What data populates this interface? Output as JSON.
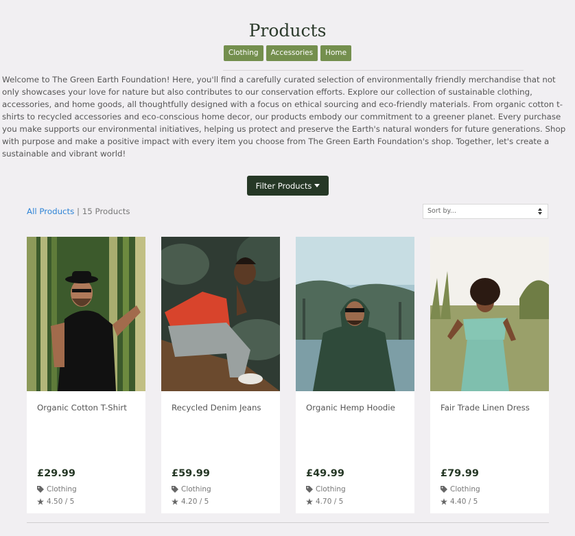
{
  "page": {
    "title": "Products"
  },
  "categories": [
    {
      "label": "Clothing"
    },
    {
      "label": "Accessories"
    },
    {
      "label": "Home"
    }
  ],
  "intro": "Welcome to The Green Earth Foundation! Here, you'll find a carefully curated selection of environmentally friendly merchandise that not only showcases your love for nature but also contributes to our conservation efforts. Explore our collection of sustainable clothing, accessories, and home goods, all thoughtfully designed with a focus on ethical sourcing and eco-friendly materials. From organic cotton t-shirts to recycled accessories and eco-conscious home decor, our products embody our commitment to a greener planet. Every purchase you make supports our environmental initiatives, helping us protect and preserve the Earth's natural wonders for future generations. Shop with purpose and make a positive impact with every item you choose from The Green Earth Foundation's shop. Together, let's create a sustainable and vibrant world!",
  "filter": {
    "label": "Filter Products"
  },
  "listing": {
    "all_link": "All Products",
    "separator": " | ",
    "count": "15 Products"
  },
  "sort": {
    "placeholder": "Sort by..."
  },
  "products": [
    {
      "name": "Organic Cotton T-Shirt",
      "price": "£29.99",
      "category": "Clothing",
      "rating": "4.50 / 5"
    },
    {
      "name": "Recycled Denim Jeans",
      "price": "£59.99",
      "category": "Clothing",
      "rating": "4.20 / 5"
    },
    {
      "name": "Organic Hemp Hoodie",
      "price": "£49.99",
      "category": "Clothing",
      "rating": "4.70 / 5"
    },
    {
      "name": "Fair Trade Linen Dress",
      "price": "£79.99",
      "category": "Clothing",
      "rating": "4.40 / 5"
    }
  ],
  "colors": {
    "accent_green": "#748f4e",
    "dark_green": "#263826",
    "link_blue": "#2f84d6",
    "background": "#f1eff2"
  },
  "icons": {
    "category": "tag-icon",
    "rating": "star-icon",
    "dropdown": "caret-down-icon",
    "sort": "sort-arrows-icon"
  }
}
